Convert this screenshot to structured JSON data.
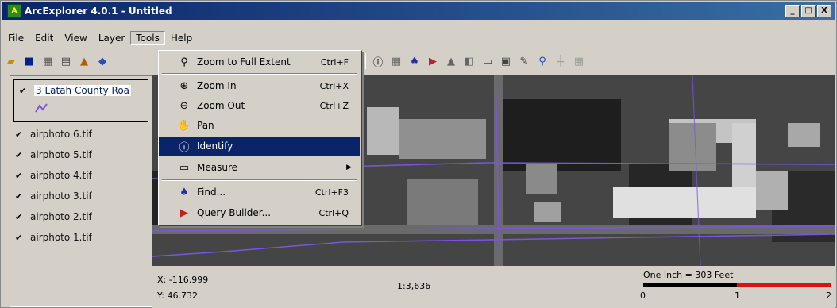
{
  "window": {
    "title": "ArcExplorer 4.0.1 - Untitled",
    "buttons": [
      "_",
      "□",
      "X"
    ]
  },
  "menubar": {
    "items": [
      "File",
      "Edit",
      "View",
      "Layer",
      "Tools",
      "Help"
    ],
    "active": "Tools"
  },
  "toolbar": {
    "left_icons": [
      "open-icon",
      "save-icon",
      "add-layer-icon",
      "print-icon",
      "export-icon",
      "image-icon"
    ],
    "right_icons": [
      "pan-icon",
      "globe-icon",
      "identify-icon",
      "table-icon",
      "find-icon",
      "query-icon",
      "buffer-icon",
      "select-icon",
      "measure-icon",
      "properties-icon",
      "edit-icon",
      "zoom-layer-icon",
      "grid-icon",
      "graticule-icon"
    ]
  },
  "layers": {
    "active": {
      "label": "3 Latah County Roa",
      "symbol": "line-symbol"
    },
    "items": [
      "airphoto 6.tif",
      "airphoto 5.tif",
      "airphoto 4.tif",
      "airphoto 3.tif",
      "airphoto 2.tif",
      "airphoto 1.tif"
    ]
  },
  "tools_menu": {
    "items": [
      {
        "icon": "zoom-extent-icon",
        "label": "Zoom to Full Extent",
        "shortcut": "Ctrl+F"
      },
      {
        "icon": "zoom-in-icon",
        "label": "Zoom In",
        "shortcut": "Ctrl+X"
      },
      {
        "icon": "zoom-out-icon",
        "label": "Zoom Out",
        "shortcut": "Ctrl+Z"
      },
      {
        "icon": "pan-icon",
        "label": "Pan",
        "shortcut": ""
      },
      {
        "icon": "identify-icon",
        "label": "Identify",
        "shortcut": ""
      },
      {
        "icon": "measure-icon",
        "label": "Measure",
        "shortcut": ""
      },
      {
        "icon": "find-icon",
        "label": "Find...",
        "shortcut": "Ctrl+F3"
      },
      {
        "icon": "query-builder-icon",
        "label": "Query Builder...",
        "shortcut": "Ctrl+Q"
      }
    ],
    "highlighted": "Identify"
  },
  "status": {
    "x": "X: -116.999",
    "y": "Y: 46.732",
    "scale": "1:3,636",
    "scalebar_label": "One Inch = 303 Feet",
    "scalebar_ticks": [
      "0",
      "1",
      "2"
    ]
  },
  "colors": {
    "title_start": "#0a246a",
    "title_end": "#3a6ea5",
    "highlight": "#0a246a",
    "roads": "#7a55e0",
    "scale_red": "#e01010"
  }
}
